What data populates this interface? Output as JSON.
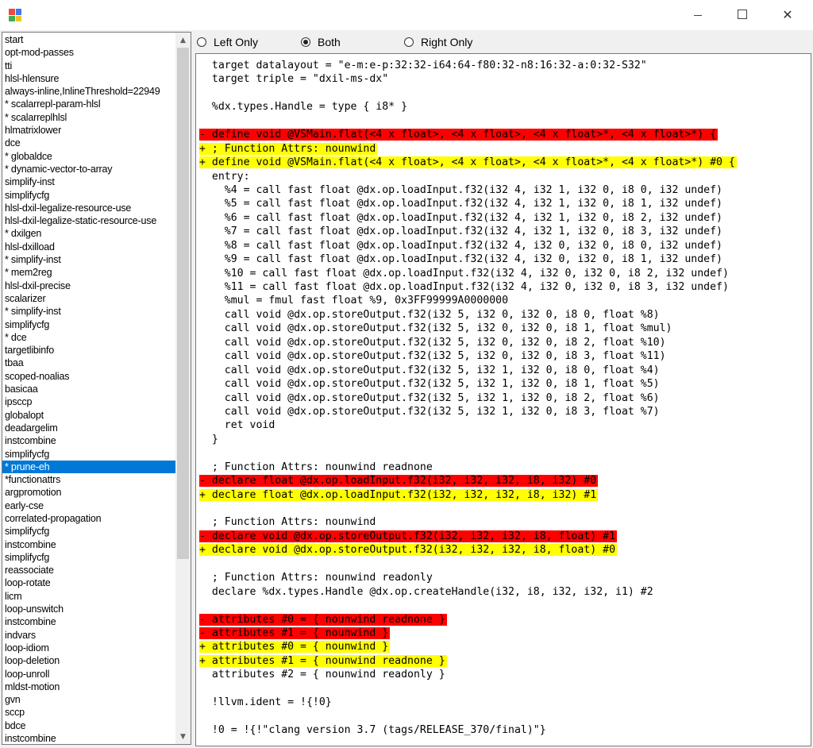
{
  "window": {
    "icon": "app-icon",
    "minimize_glyph": "—",
    "maximize_glyph": "☐",
    "close_glyph": "✕"
  },
  "passes": [
    "start",
    "opt-mod-passes",
    "tti",
    "hlsl-hlensure",
    "always-inline,InlineThreshold=22949",
    "* scalarrepl-param-hlsl",
    "* scalarreplhlsl",
    "hlmatrixlower",
    "dce",
    "* globaldce",
    "* dynamic-vector-to-array",
    "simplify-inst",
    "simplifycfg",
    "hlsl-dxil-legalize-resource-use",
    "hlsl-dxil-legalize-static-resource-use",
    "* dxilgen",
    "hlsl-dxilload",
    "* simplify-inst",
    "* mem2reg",
    "hlsl-dxil-precise",
    "scalarizer",
    "* simplify-inst",
    "simplifycfg",
    "* dce",
    "targetlibinfo",
    "tbaa",
    "scoped-noalias",
    "basicaa",
    "ipsccp",
    "globalopt",
    "deadargelim",
    "instcombine",
    "simplifycfg",
    "* prune-eh",
    "*functionattrs",
    "argpromotion",
    "early-cse",
    "correlated-propagation",
    "simplifycfg",
    "instcombine",
    "simplifycfg",
    "reassociate",
    "loop-rotate",
    "licm",
    "loop-unswitch",
    "instcombine",
    "indvars",
    "loop-idiom",
    "loop-deletion",
    "loop-unroll",
    "mldst-motion",
    "gvn",
    "sccp",
    "bdce",
    "instcombine"
  ],
  "selected_index": 33,
  "scrollbar": {
    "up_arrow": "▲",
    "down_arrow": "▼"
  },
  "view_mode": {
    "options": [
      {
        "label": "Left Only",
        "selected": false
      },
      {
        "label": "Both",
        "selected": true
      },
      {
        "label": "Right Only",
        "selected": false
      }
    ]
  },
  "diff_lines": [
    {
      "text": "  target datalayout = \"e-m:e-p:32:32-i64:64-f80:32-n8:16:32-a:0:32-S32\"",
      "kind": "same"
    },
    {
      "text": "  target triple = \"dxil-ms-dx\"",
      "kind": "same"
    },
    {
      "text": "",
      "kind": "same"
    },
    {
      "text": "  %dx.types.Handle = type { i8* }",
      "kind": "same"
    },
    {
      "text": "",
      "kind": "same"
    },
    {
      "text": "- define void @VSMain.flat(<4 x float>, <4 x float>, <4 x float>*, <4 x float>*) {",
      "kind": "removed"
    },
    {
      "text": "+ ; Function Attrs: nounwind",
      "kind": "added"
    },
    {
      "text": "+ define void @VSMain.flat(<4 x float>, <4 x float>, <4 x float>*, <4 x float>*) #0 {",
      "kind": "added"
    },
    {
      "text": "  entry:",
      "kind": "same"
    },
    {
      "text": "    %4 = call fast float @dx.op.loadInput.f32(i32 4, i32 1, i32 0, i8 0, i32 undef)",
      "kind": "same"
    },
    {
      "text": "    %5 = call fast float @dx.op.loadInput.f32(i32 4, i32 1, i32 0, i8 1, i32 undef)",
      "kind": "same"
    },
    {
      "text": "    %6 = call fast float @dx.op.loadInput.f32(i32 4, i32 1, i32 0, i8 2, i32 undef)",
      "kind": "same"
    },
    {
      "text": "    %7 = call fast float @dx.op.loadInput.f32(i32 4, i32 1, i32 0, i8 3, i32 undef)",
      "kind": "same"
    },
    {
      "text": "    %8 = call fast float @dx.op.loadInput.f32(i32 4, i32 0, i32 0, i8 0, i32 undef)",
      "kind": "same"
    },
    {
      "text": "    %9 = call fast float @dx.op.loadInput.f32(i32 4, i32 0, i32 0, i8 1, i32 undef)",
      "kind": "same"
    },
    {
      "text": "    %10 = call fast float @dx.op.loadInput.f32(i32 4, i32 0, i32 0, i8 2, i32 undef)",
      "kind": "same"
    },
    {
      "text": "    %11 = call fast float @dx.op.loadInput.f32(i32 4, i32 0, i32 0, i8 3, i32 undef)",
      "kind": "same"
    },
    {
      "text": "    %mul = fmul fast float %9, 0x3FF99999A0000000",
      "kind": "same"
    },
    {
      "text": "    call void @dx.op.storeOutput.f32(i32 5, i32 0, i32 0, i8 0, float %8)",
      "kind": "same"
    },
    {
      "text": "    call void @dx.op.storeOutput.f32(i32 5, i32 0, i32 0, i8 1, float %mul)",
      "kind": "same"
    },
    {
      "text": "    call void @dx.op.storeOutput.f32(i32 5, i32 0, i32 0, i8 2, float %10)",
      "kind": "same"
    },
    {
      "text": "    call void @dx.op.storeOutput.f32(i32 5, i32 0, i32 0, i8 3, float %11)",
      "kind": "same"
    },
    {
      "text": "    call void @dx.op.storeOutput.f32(i32 5, i32 1, i32 0, i8 0, float %4)",
      "kind": "same"
    },
    {
      "text": "    call void @dx.op.storeOutput.f32(i32 5, i32 1, i32 0, i8 1, float %5)",
      "kind": "same"
    },
    {
      "text": "    call void @dx.op.storeOutput.f32(i32 5, i32 1, i32 0, i8 2, float %6)",
      "kind": "same"
    },
    {
      "text": "    call void @dx.op.storeOutput.f32(i32 5, i32 1, i32 0, i8 3, float %7)",
      "kind": "same"
    },
    {
      "text": "    ret void",
      "kind": "same"
    },
    {
      "text": "  }",
      "kind": "same"
    },
    {
      "text": "",
      "kind": "same"
    },
    {
      "text": "  ; Function Attrs: nounwind readnone",
      "kind": "same"
    },
    {
      "text": "- declare float @dx.op.loadInput.f32(i32, i32, i32, i8, i32) #0",
      "kind": "removed"
    },
    {
      "text": "+ declare float @dx.op.loadInput.f32(i32, i32, i32, i8, i32) #1",
      "kind": "added"
    },
    {
      "text": "",
      "kind": "same"
    },
    {
      "text": "  ; Function Attrs: nounwind",
      "kind": "same"
    },
    {
      "text": "- declare void @dx.op.storeOutput.f32(i32, i32, i32, i8, float) #1",
      "kind": "removed"
    },
    {
      "text": "+ declare void @dx.op.storeOutput.f32(i32, i32, i32, i8, float) #0",
      "kind": "added"
    },
    {
      "text": "",
      "kind": "same"
    },
    {
      "text": "  ; Function Attrs: nounwind readonly",
      "kind": "same"
    },
    {
      "text": "  declare %dx.types.Handle @dx.op.createHandle(i32, i8, i32, i32, i1) #2",
      "kind": "same"
    },
    {
      "text": "",
      "kind": "same"
    },
    {
      "text": "- attributes #0 = { nounwind readnone }",
      "kind": "removed"
    },
    {
      "text": "- attributes #1 = { nounwind }",
      "kind": "removed"
    },
    {
      "text": "+ attributes #0 = { nounwind }",
      "kind": "added"
    },
    {
      "text": "+ attributes #1 = { nounwind readnone }",
      "kind": "added"
    },
    {
      "text": "  attributes #2 = { nounwind readonly }",
      "kind": "same"
    },
    {
      "text": "",
      "kind": "same"
    },
    {
      "text": "  !llvm.ident = !{!0}",
      "kind": "same"
    },
    {
      "text": "",
      "kind": "same"
    },
    {
      "text": "  !0 = !{!\"clang version 3.7 (tags/RELEASE_370/final)\"}",
      "kind": "same"
    }
  ],
  "colors": {
    "removed": "#ff0000",
    "added": "#ffff00",
    "selection": "#0078d7"
  }
}
